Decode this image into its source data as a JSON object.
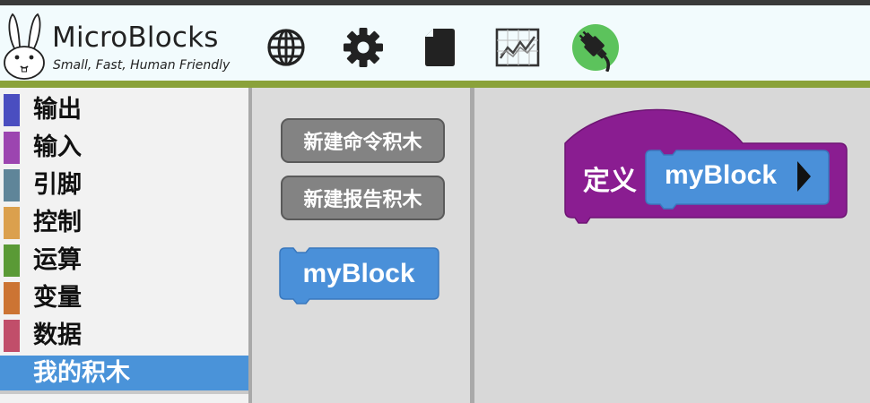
{
  "app": {
    "title": "MicroBlocks",
    "tagline": "Small, Fast, Human Friendly"
  },
  "toolbar": {
    "buttons": [
      {
        "name": "globe-icon"
      },
      {
        "name": "gear-icon"
      },
      {
        "name": "file-icon"
      },
      {
        "name": "graph-icon"
      },
      {
        "name": "usb-connect-icon",
        "status_color": "#5cc35c"
      }
    ]
  },
  "categories": [
    {
      "label": "输出",
      "color": "#4a4ec0"
    },
    {
      "label": "输入",
      "color": "#9c45b0"
    },
    {
      "label": "引脚",
      "color": "#5f8599"
    },
    {
      "label": "控制",
      "color": "#dba04d"
    },
    {
      "label": "运算",
      "color": "#5a9a36"
    },
    {
      "label": "变量",
      "color": "#cc7433"
    },
    {
      "label": "数据",
      "color": "#c14e6a"
    },
    {
      "label": "我的积木",
      "color": "#4a93d9",
      "selected": true
    }
  ],
  "palette": {
    "new_command_block": "新建命令积木",
    "new_reporter_block": "新建报告积木",
    "custom_block": "myBlock"
  },
  "script": {
    "define_label": "定义",
    "block_name": "myBlock"
  },
  "colors": {
    "custom_block": "#4a90d9",
    "hat_block": "#8a1d91"
  }
}
